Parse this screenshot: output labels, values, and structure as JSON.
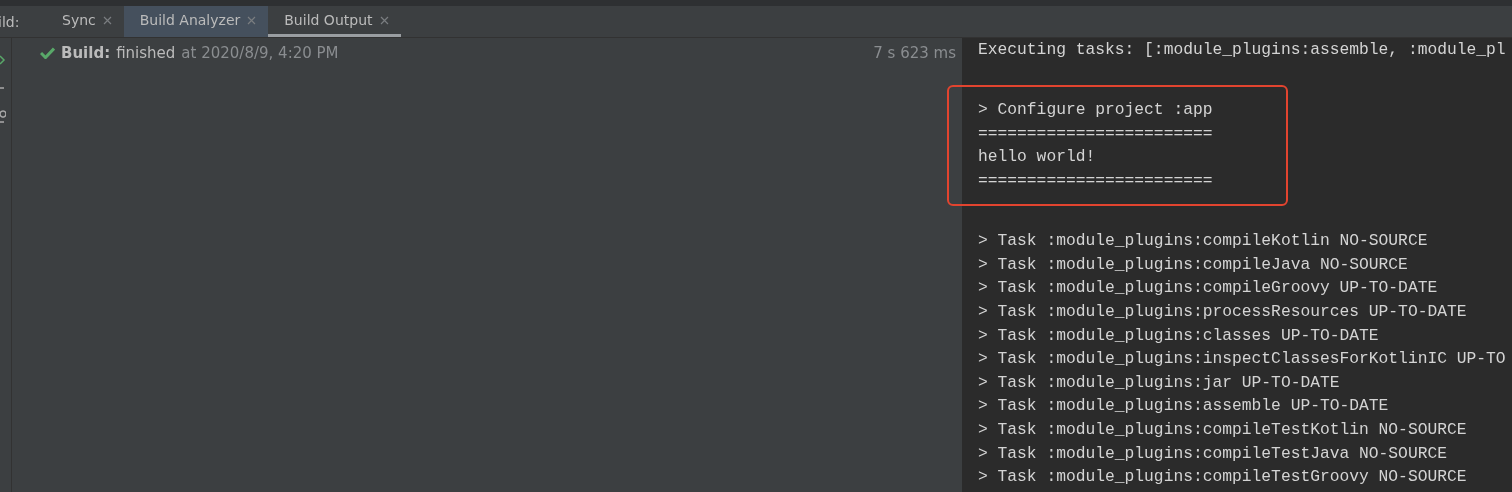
{
  "tool_window": {
    "label": "ild:",
    "tabs": [
      {
        "label": "Sync",
        "selected": false,
        "highlighted": false
      },
      {
        "label": "Build Analyzer",
        "selected": false,
        "highlighted": true
      },
      {
        "label": "Build Output",
        "selected": true,
        "highlighted": false
      }
    ]
  },
  "build_tree": {
    "succeeded": true,
    "title": "Build:",
    "result": "finished",
    "time": "at 2020/8/9, 4:20 PM",
    "duration": "7 s 623 ms"
  },
  "console": {
    "lines_before": [
      "Executing tasks: [:module_plugins:assemble, :module_pl"
    ],
    "highlight_box": {
      "lines": [
        "> Configure project :app",
        "========================",
        "hello world!",
        "========================"
      ]
    },
    "lines_after": [
      "> Task :module_plugins:compileKotlin NO-SOURCE",
      "> Task :module_plugins:compileJava NO-SOURCE",
      "> Task :module_plugins:compileGroovy UP-TO-DATE",
      "> Task :module_plugins:processResources UP-TO-DATE",
      "> Task :module_plugins:classes UP-TO-DATE",
      "> Task :module_plugins:inspectClassesForKotlinIC UP-TO",
      "> Task :module_plugins:jar UP-TO-DATE",
      "> Task :module_plugins:assemble UP-TO-DATE",
      "> Task :module_plugins:compileTestKotlin NO-SOURCE",
      "> Task :module_plugins:compileTestJava NO-SOURCE",
      "> Task :module_plugins:compileTestGroovy NO-SOURCE"
    ]
  }
}
